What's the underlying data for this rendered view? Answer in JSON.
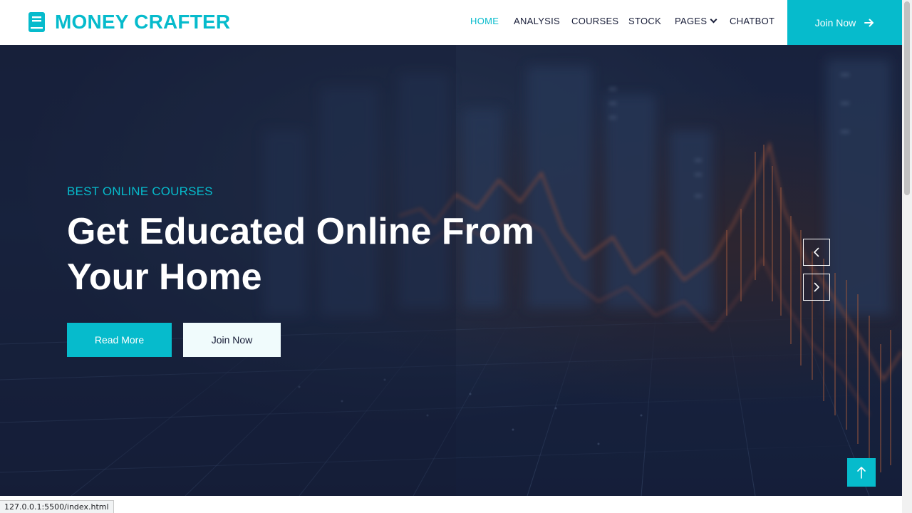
{
  "brand": {
    "name": "MONEY CRAFTER",
    "icon": "book-icon"
  },
  "nav": {
    "items": [
      {
        "label": "HOME",
        "active": true
      },
      {
        "label": "ANALYSIS"
      },
      {
        "label": "COURSES"
      },
      {
        "label": "STOCK"
      },
      {
        "label": "PAGES",
        "has_dropdown": true
      },
      {
        "label": "CHATBOT"
      }
    ],
    "cta_label": "Join Now",
    "cta_icon": "arrow-right-icon"
  },
  "hero": {
    "subtitle": "BEST ONLINE COURSES",
    "headline": "Get Educated Online From Your Home",
    "read_more_label": "Read More",
    "join_label": "Join Now",
    "prev_icon": "chevron-left-icon",
    "next_icon": "chevron-right-icon"
  },
  "back_to_top_icon": "arrow-up-icon",
  "status_bar": {
    "url": "127.0.0.1:5500/index.html"
  },
  "colors": {
    "accent": "#06BBCC",
    "dark": "#181d38",
    "light_button": "#F0FBFC"
  }
}
